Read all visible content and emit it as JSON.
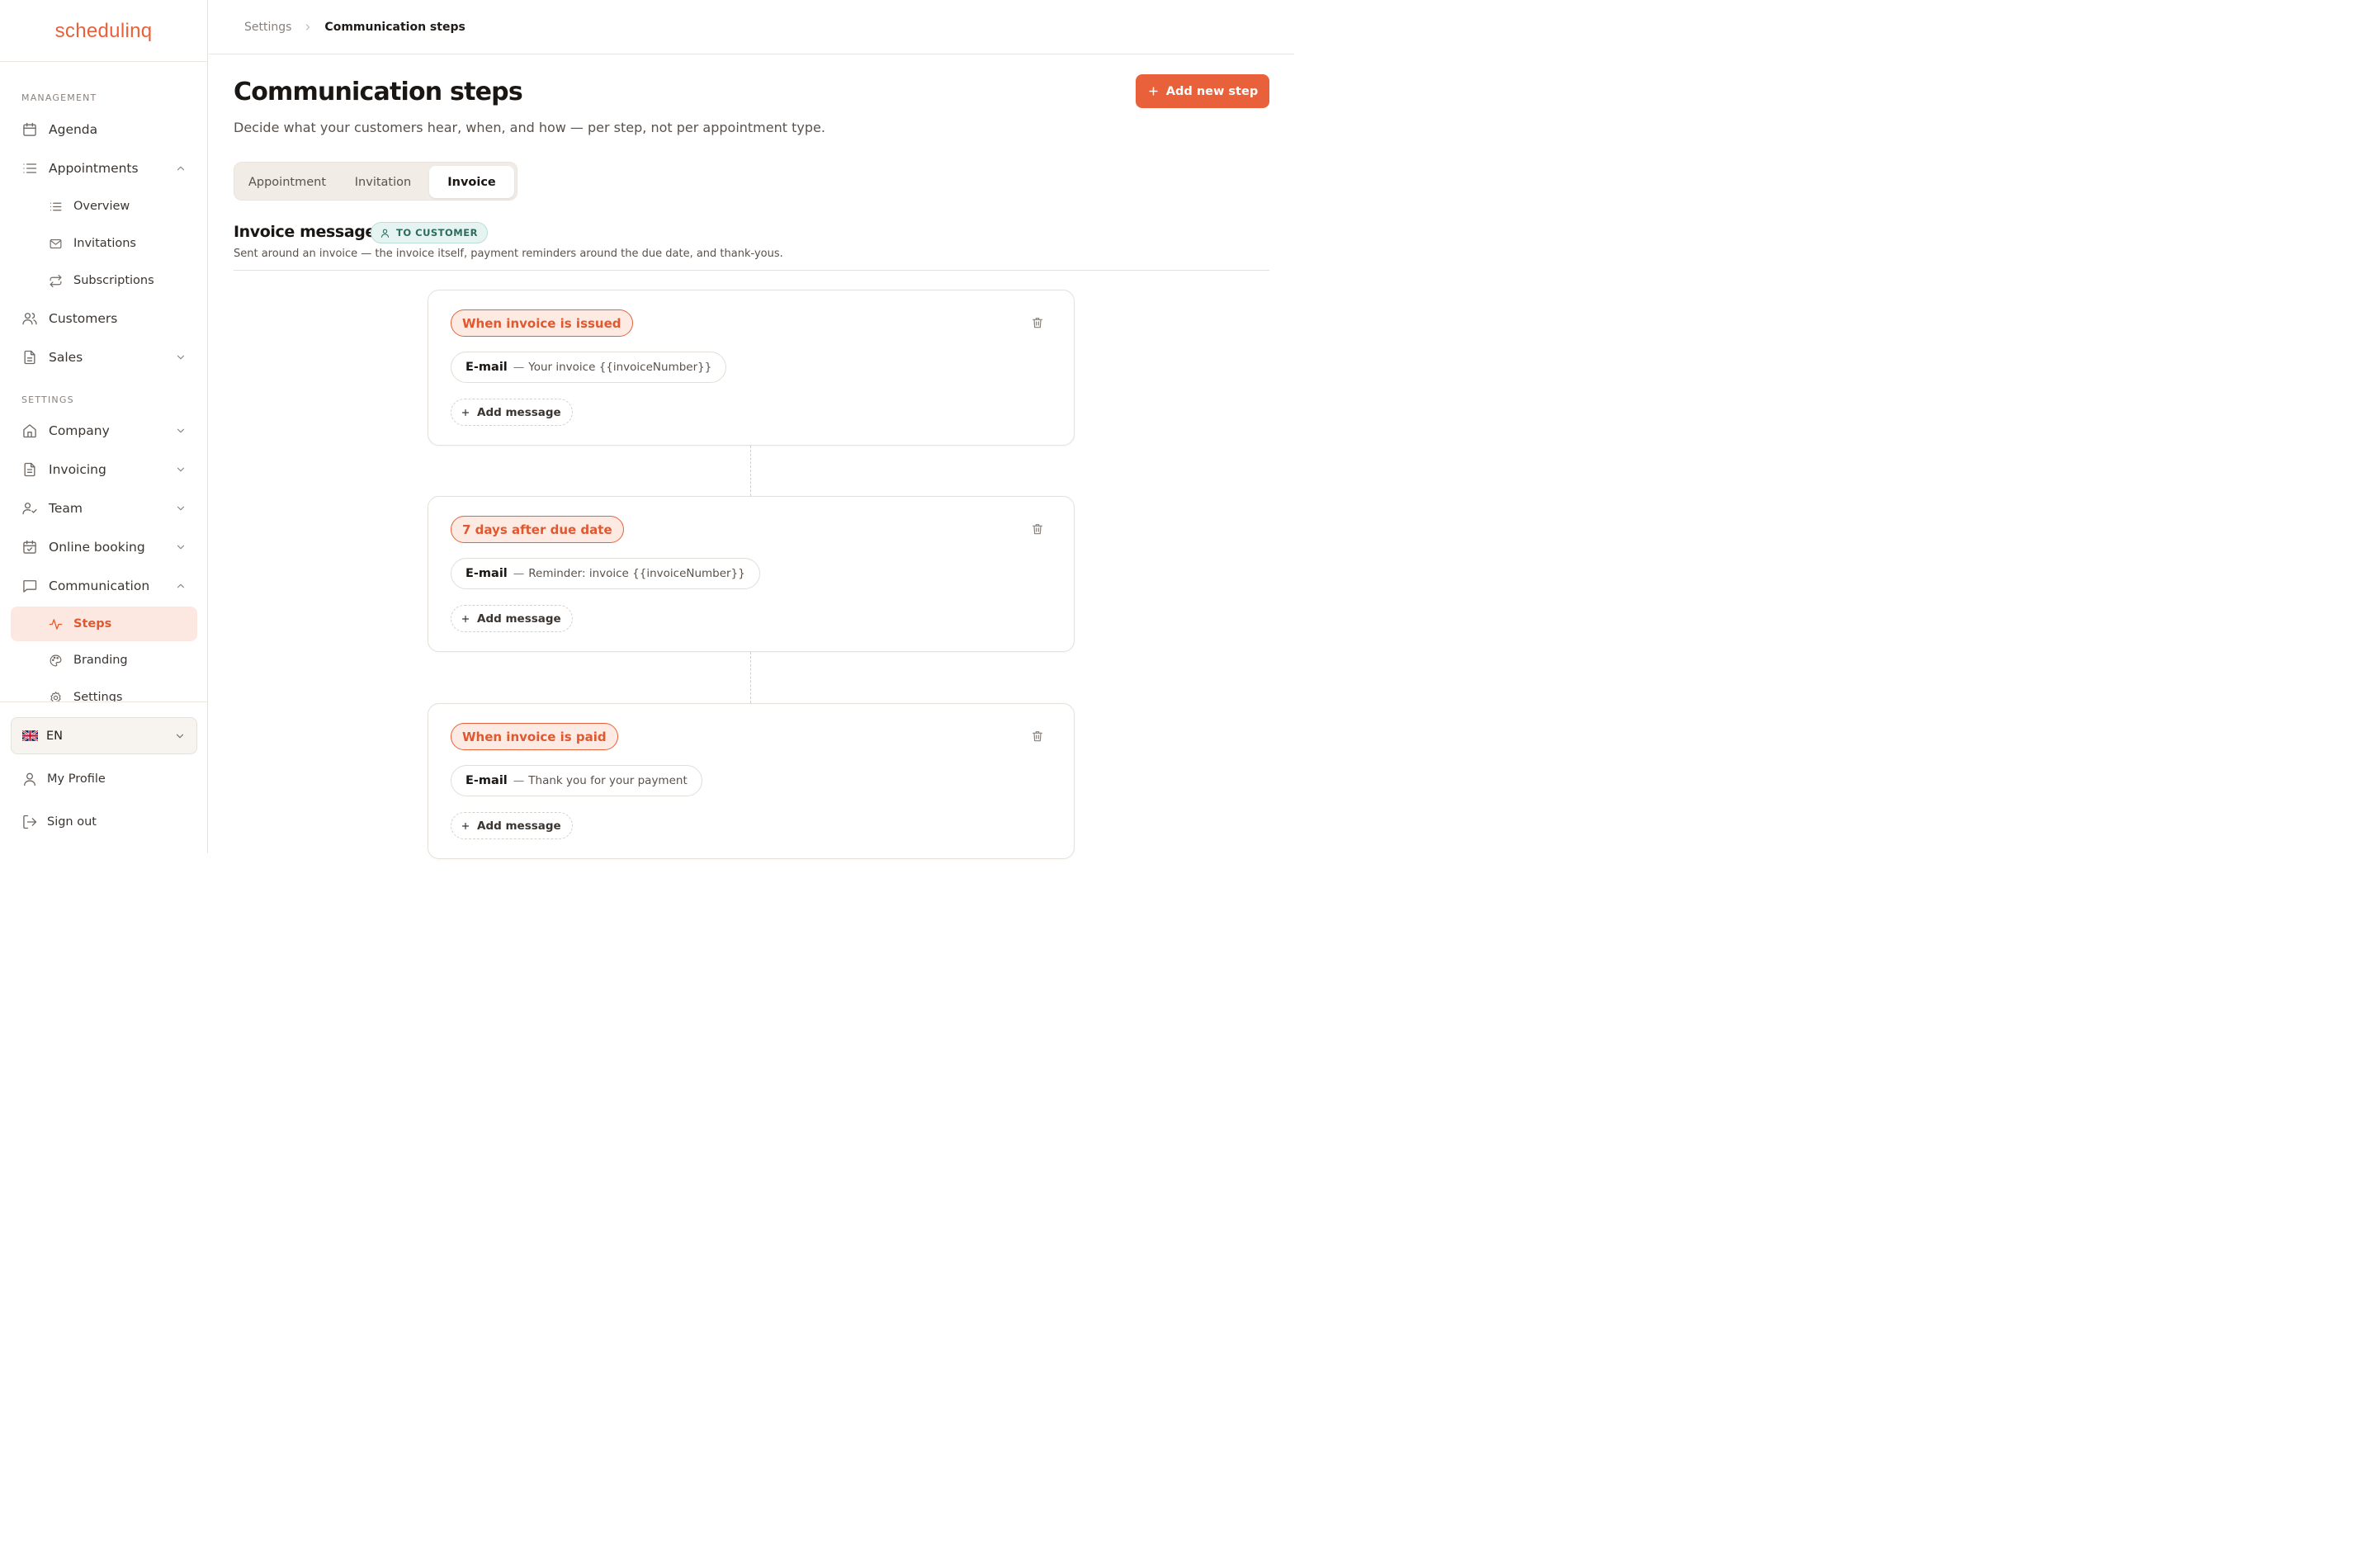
{
  "app": {
    "logo": "schedulinq"
  },
  "sidebar": {
    "management_label": "MANAGEMENT",
    "settings_label": "SETTINGS",
    "items": {
      "agenda": "Agenda",
      "appointments": "Appointments",
      "overview": "Overview",
      "invitations": "Invitations",
      "subscriptions": "Subscriptions",
      "customers": "Customers",
      "sales": "Sales",
      "company": "Company",
      "invoicing": "Invoicing",
      "team": "Team",
      "online_booking": "Online booking",
      "communication": "Communication",
      "steps": "Steps",
      "branding": "Branding",
      "settings": "Settings"
    },
    "language": {
      "code": "EN"
    },
    "my_profile": "My Profile",
    "sign_out": "Sign out"
  },
  "breadcrumb": {
    "parent": "Settings",
    "current": "Communication steps"
  },
  "page": {
    "title": "Communication steps",
    "subtitle": "Decide what your customers hear, when, and how — per step, not per appointment type.",
    "add_button": "Add new step"
  },
  "tabs": {
    "appointment": "Appointment",
    "invitation": "Invitation",
    "invoice": "Invoice",
    "active": "Invoice"
  },
  "section": {
    "title": "Invoice messages",
    "audience": "TO CUSTOMER",
    "description": "Sent around an invoice — the invoice itself, payment reminders around the due date, and thank-yous."
  },
  "steps": [
    {
      "trigger": "When invoice is issued",
      "messages": [
        {
          "channel": "E-mail",
          "dash": "—",
          "subject": "Your invoice {{invoiceNumber}}"
        }
      ],
      "add_label": "Add message"
    },
    {
      "trigger": "7 days after due date",
      "messages": [
        {
          "channel": "E-mail",
          "dash": "—",
          "subject": "Reminder: invoice {{invoiceNumber}}"
        }
      ],
      "add_label": "Add message"
    },
    {
      "trigger": "When invoice is paid",
      "messages": [
        {
          "channel": "E-mail",
          "dash": "—",
          "subject": "Thank you for your payment"
        }
      ],
      "add_label": "Add message"
    }
  ],
  "colors": {
    "brand": "#e8613a",
    "active_bg": "#fde8e1",
    "badge_bg": "#e6f4f1",
    "badge_text": "#2c6b5d"
  },
  "icons": {
    "agenda": "calendar-icon",
    "appointments": "list-icon",
    "overview": "list-icon",
    "invitations": "mail-icon",
    "subscriptions": "repeat-icon",
    "customers": "users-icon",
    "sales": "file-icon",
    "company": "home-icon",
    "invoicing": "file-text-icon",
    "team": "user-check-icon",
    "online_booking": "calendar-check-icon",
    "communication": "message-icon",
    "steps": "activity-icon",
    "branding": "palette-icon",
    "settings": "gear-icon",
    "profile": "user-icon",
    "sign_out": "log-out-icon",
    "trash": "trash-icon",
    "add": "plus-icon"
  }
}
